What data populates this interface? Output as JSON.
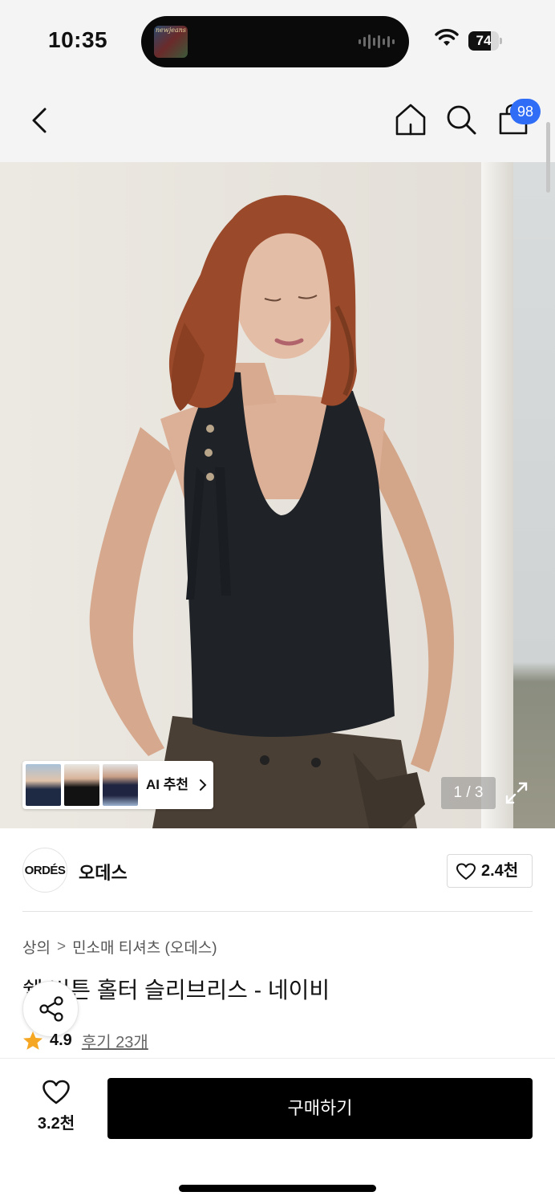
{
  "status_bar": {
    "time": "10:35",
    "now_playing_art_text": "newjeans",
    "battery": {
      "label": "74",
      "level": 0.74
    }
  },
  "nav": {
    "back_icon": "chevron-left-icon",
    "home_icon": "home-icon",
    "search_icon": "search-icon",
    "bag_icon": "shopping-bag-icon",
    "cart_count": "98"
  },
  "gallery": {
    "ai_recommend_label": "AI 추천",
    "counter": "1 / 3",
    "expand_icon": "expand-icon"
  },
  "brand": {
    "logo_text": "ORDÉS",
    "name": "오데스",
    "like_count": "2.4천"
  },
  "product": {
    "breadcrumb": [
      "상의",
      "민소매 티셔츠 (오데스)"
    ],
    "breadcrumb_sep": ">",
    "title": "쉘 버튼 홀터 슬리브리스 - 네이비",
    "rating": "4.9",
    "reviews": "후기 23개"
  },
  "bottom_bar": {
    "wish_count": "3.2천",
    "buy_label": "구매하기"
  },
  "colors": {
    "accent_blue": "#2f6df6",
    "star": "#f5a623",
    "buy_button": "#000000"
  }
}
